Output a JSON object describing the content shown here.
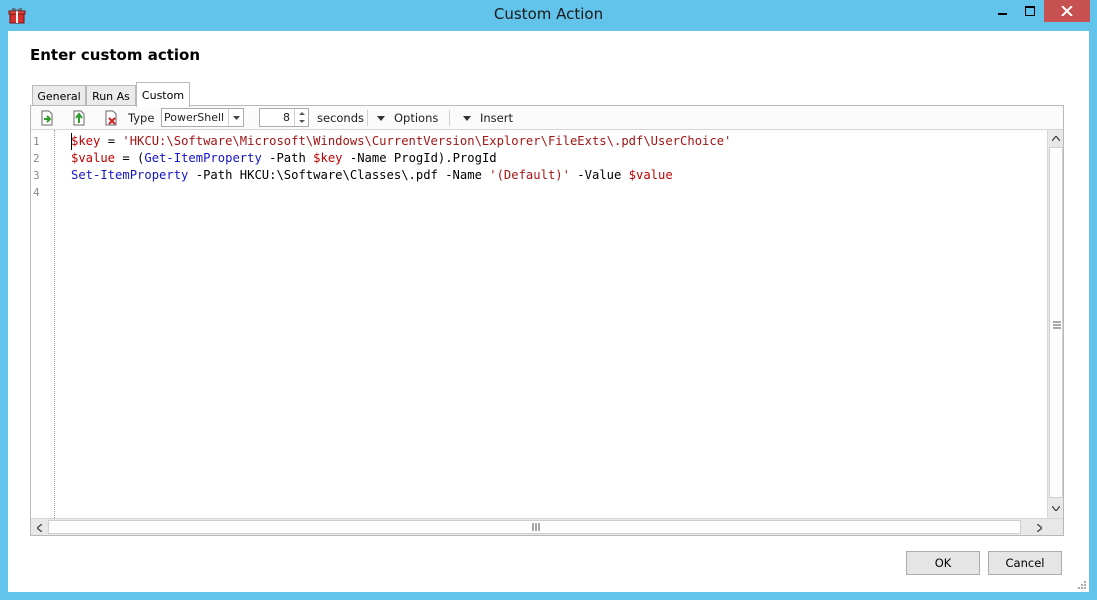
{
  "window": {
    "title": "Custom Action",
    "app_icon": "gift-box-icon",
    "controls": [
      "minimize-icon",
      "maximize-icon",
      "close-icon"
    ]
  },
  "heading": "Enter custom action",
  "tabs": [
    {
      "label": "General",
      "active": false
    },
    {
      "label": "Run As",
      "active": false
    },
    {
      "label": "Custom",
      "active": true
    }
  ],
  "toolbar": {
    "icons": [
      "import-icon",
      "export-icon",
      "clear-icon"
    ],
    "type_label": "Type",
    "type_value": "PowerShell",
    "timeout_value": "8",
    "timeout_unit": "seconds",
    "options_label": "Options",
    "insert_label": "Insert"
  },
  "editor": {
    "line_numbers": [
      "1",
      "2",
      "3",
      "4"
    ],
    "lines": [
      [
        {
          "t": "$key",
          "k": "var"
        },
        {
          "t": " = ",
          "k": "plain"
        },
        {
          "t": "'HKCU:\\Software\\Microsoft\\Windows\\CurrentVersion\\Explorer\\FileExts\\.pdf\\UserChoice'",
          "k": "str"
        }
      ],
      [
        {
          "t": "$value",
          "k": "var"
        },
        {
          "t": " = (",
          "k": "plain"
        },
        {
          "t": "Get-ItemProperty",
          "k": "cmd"
        },
        {
          "t": " -Path ",
          "k": "plain"
        },
        {
          "t": "$key",
          "k": "var"
        },
        {
          "t": " -Name ProgId).ProgId",
          "k": "plain"
        }
      ],
      [
        {
          "t": "Set-ItemProperty",
          "k": "cmd"
        },
        {
          "t": " -Path HKCU:\\Software\\Classes\\.pdf -Name ",
          "k": "plain"
        },
        {
          "t": "'(Default)'",
          "k": "str"
        },
        {
          "t": " -Value ",
          "k": "plain"
        },
        {
          "t": "$value",
          "k": "var"
        }
      ],
      []
    ],
    "colors": {
      "var": "#c00000",
      "str": "#a31515",
      "cmd": "#1515c8",
      "plain": "#000000"
    }
  },
  "buttons": {
    "ok": "OK",
    "cancel": "Cancel"
  },
  "colors": {
    "frame": "#62c3eb",
    "close_button": "#c75050"
  }
}
